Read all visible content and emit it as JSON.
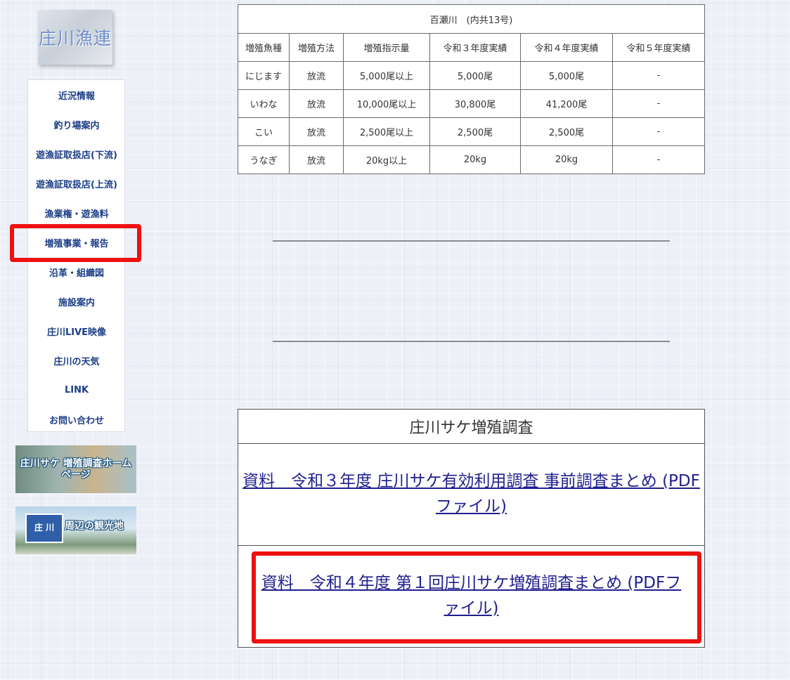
{
  "logo": {
    "text": "庄川漁連"
  },
  "nav": {
    "items": [
      "近況情報",
      "釣り場案内",
      "遊漁証取扱店(下流)",
      "遊漁証取扱店(上流)",
      "漁業権・遊漁料",
      "増殖事業・報告",
      "沿革・組織図",
      "施設案内",
      "庄川LIVE映像",
      "庄川の天気",
      "LINK",
      "お問い合わせ"
    ],
    "highlighted_index": 5
  },
  "banners": {
    "salmon_home": "庄川サケ 増殖調査ホームページ",
    "tourism_sign": "庄 川",
    "tourism": "周辺の観光地"
  },
  "stock_table": {
    "caption": "百瀬川　(内共13号)",
    "headers": [
      "増殖魚種",
      "増殖方法",
      "増殖指示量",
      "令和３年度実績",
      "令和４年度実績",
      "令和５年度実績"
    ],
    "rows": [
      [
        "にじます",
        "放流",
        "5,000尾以上",
        "5,000尾",
        "5,000尾",
        "-"
      ],
      [
        "いわな",
        "放流",
        "10,000尾以上",
        "30,800尾",
        "41,200尾",
        "-"
      ],
      [
        "こい",
        "放流",
        "2,500尾以上",
        "2,500尾",
        "2,500尾",
        "-"
      ],
      [
        "うなぎ",
        "放流",
        "20kg以上",
        "20kg",
        "20kg",
        "-"
      ]
    ]
  },
  "salmon_survey": {
    "title": "庄川サケ増殖調査",
    "link1": "資料　令和３年度 庄川サケ有効利用調査 事前調査まとめ (PDFファイル)",
    "link2": "資料　令和４年度 第１回庄川サケ増殖調査まとめ (PDFファイル)"
  },
  "colors": {
    "highlight": "#ee1111",
    "nav_text": "#1c3e86",
    "link": "#1f1f8f"
  }
}
